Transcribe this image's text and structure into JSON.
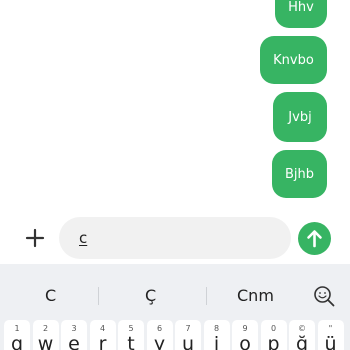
{
  "chat": {
    "messages": [
      {
        "text": "Hhv"
      },
      {
        "text": "Knvbo"
      },
      {
        "text": "Jvbj"
      },
      {
        "text": "Bjhb"
      }
    ]
  },
  "composer": {
    "plus_icon": "plus-icon",
    "input_value": "c",
    "send_icon": "send-arrow-up-icon",
    "accent": "#37b463"
  },
  "keyboard": {
    "suggestions": [
      "C",
      "Ç",
      "Cnm"
    ],
    "search_icon": "emoji-search-icon",
    "keys": [
      {
        "num": "1",
        "ch": "q"
      },
      {
        "num": "2",
        "ch": "w"
      },
      {
        "num": "3",
        "ch": "e"
      },
      {
        "num": "4",
        "ch": "r"
      },
      {
        "num": "5",
        "ch": "t"
      },
      {
        "num": "6",
        "ch": "y"
      },
      {
        "num": "7",
        "ch": "u"
      },
      {
        "num": "8",
        "ch": "i"
      },
      {
        "num": "9",
        "ch": "o"
      },
      {
        "num": "0",
        "ch": "p"
      },
      {
        "num": "©",
        "ch": "ğ"
      },
      {
        "num": "\"",
        "ch": "ü"
      }
    ]
  }
}
